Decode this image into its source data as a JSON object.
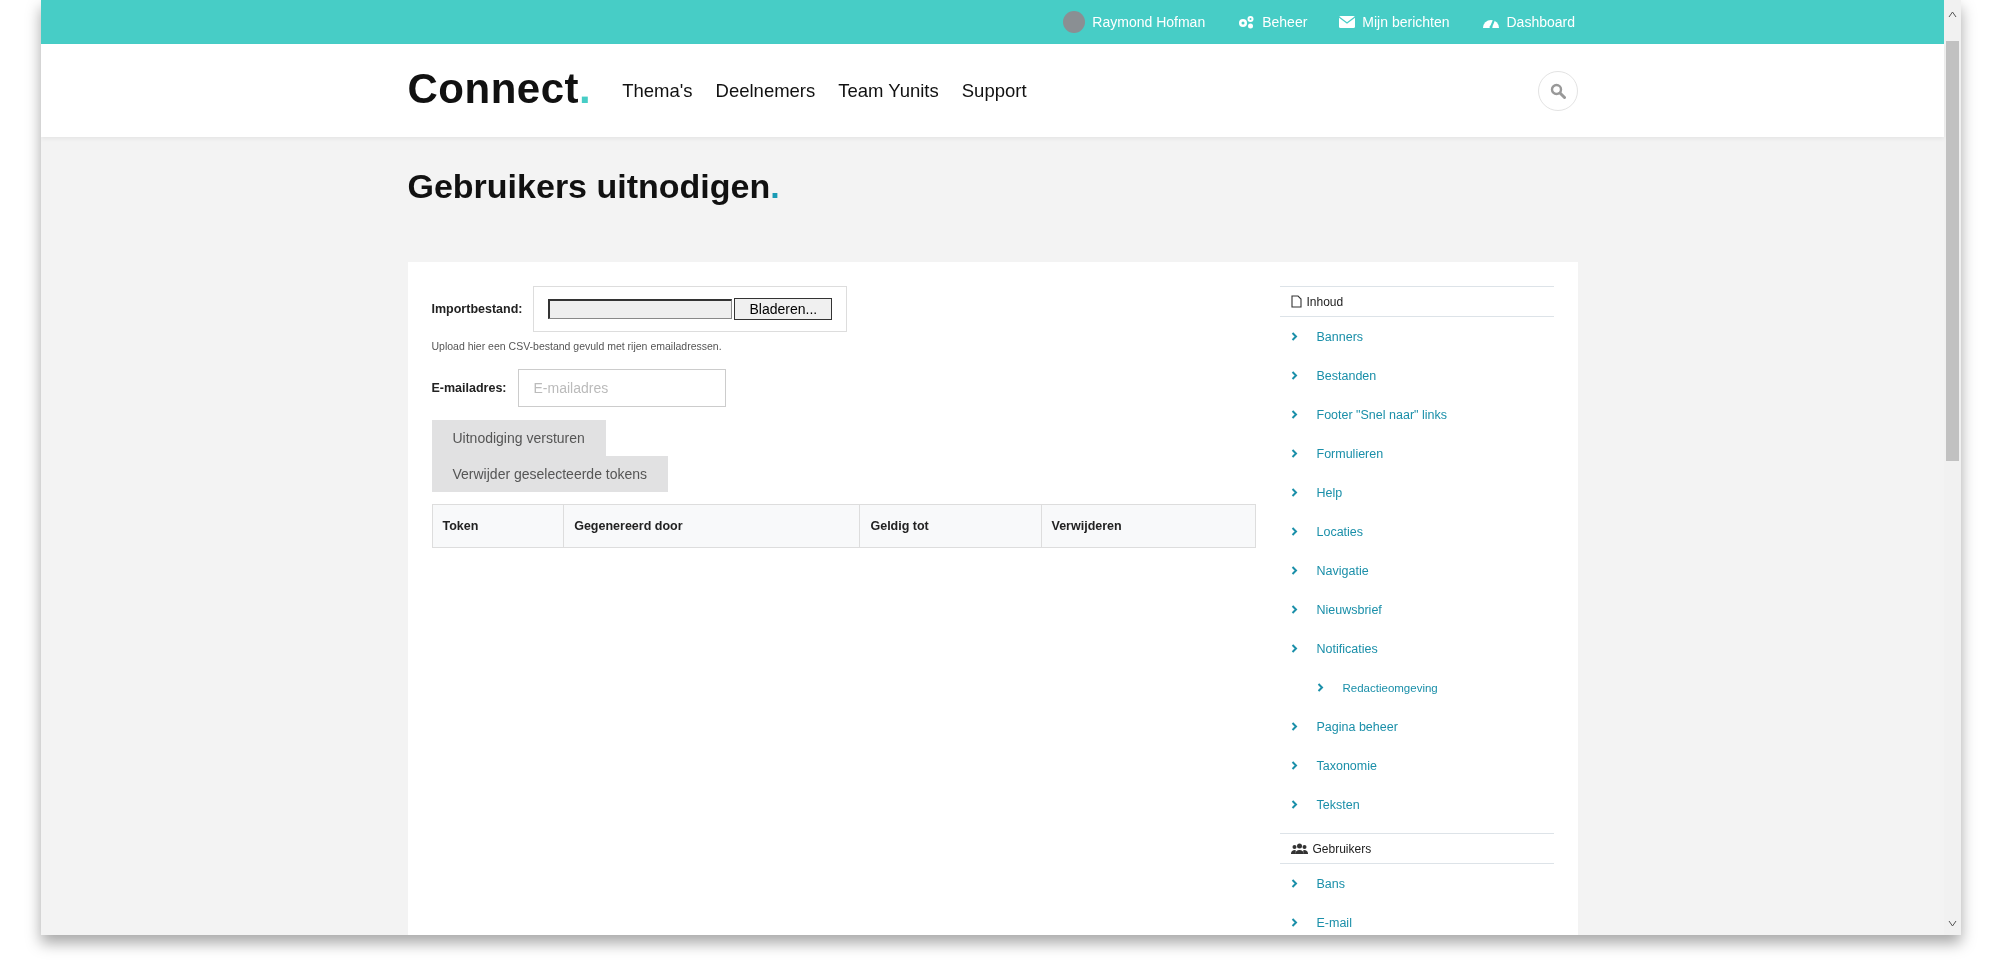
{
  "top_bar": {
    "user": "Raymond Hofman",
    "links": [
      {
        "kind": "gears",
        "label": "Beheer"
      },
      {
        "kind": "envelope",
        "label": "Mijn berichten"
      },
      {
        "kind": "gauge",
        "label": "Dashboard"
      }
    ]
  },
  "header": {
    "logo": "Connect",
    "logo_mark": ".",
    "nav": [
      "Thema's",
      "Deelnemers",
      "Team Yunits",
      "Support"
    ]
  },
  "page_title": "Gebruikers uitnodigen",
  "page_title_mark": ".",
  "form": {
    "import_label": "Importbestand:",
    "browse_button": "Bladeren...",
    "import_help": "Upload hier een CSV-bestand gevuld met rijen emailadressen.",
    "email_label": "E-mailadres:",
    "email_placeholder": "E-mailadres",
    "buttons": [
      "Uitnodiging versturen",
      "Verwijder geselecteerde tokens"
    ]
  },
  "table": {
    "columns": [
      "Token",
      "Gegenereerd door",
      "Geldig tot",
      "Verwijderen"
    ]
  },
  "sidebar": {
    "sections": [
      {
        "kind": "file",
        "title": "Inhoud",
        "items": [
          {
            "label": "Banners"
          },
          {
            "label": "Bestanden"
          },
          {
            "label": "Footer \"Snel naar\" links"
          },
          {
            "label": "Formulieren"
          },
          {
            "label": "Help"
          },
          {
            "label": "Locaties"
          },
          {
            "label": "Navigatie"
          },
          {
            "label": "Nieuwsbrief"
          },
          {
            "label": "Notificaties",
            "children": [
              {
                "label": "Redactieomgeving"
              }
            ]
          },
          {
            "label": "Pagina beheer"
          },
          {
            "label": "Taxonomie"
          },
          {
            "label": "Teksten"
          }
        ]
      },
      {
        "kind": "users",
        "title": "Gebruikers",
        "items": [
          {
            "label": "Bans"
          },
          {
            "label": "E-mail"
          }
        ]
      }
    ]
  }
}
